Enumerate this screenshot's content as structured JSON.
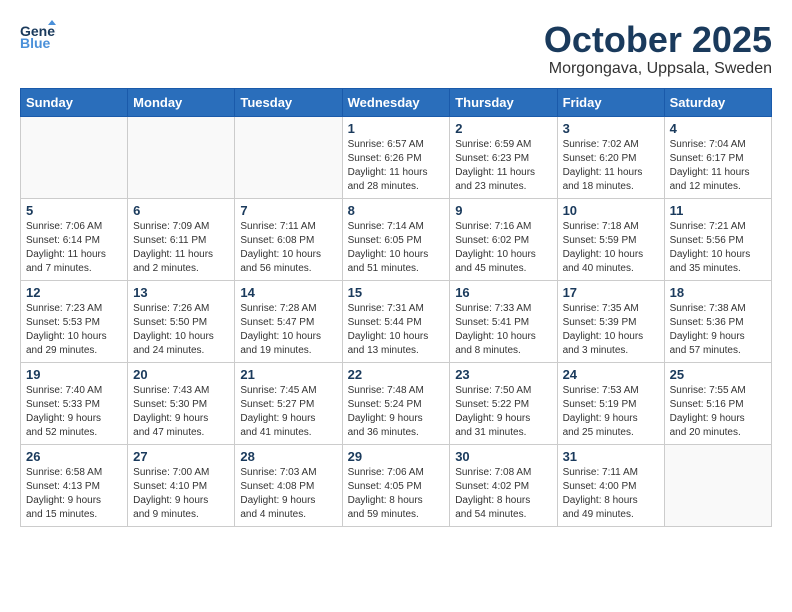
{
  "header": {
    "logo_line1": "General",
    "logo_line2": "Blue",
    "month": "October 2025",
    "location": "Morgongava, Uppsala, Sweden"
  },
  "weekdays": [
    "Sunday",
    "Monday",
    "Tuesday",
    "Wednesday",
    "Thursday",
    "Friday",
    "Saturday"
  ],
  "weeks": [
    [
      {
        "day": "",
        "info": ""
      },
      {
        "day": "",
        "info": ""
      },
      {
        "day": "",
        "info": ""
      },
      {
        "day": "1",
        "info": "Sunrise: 6:57 AM\nSunset: 6:26 PM\nDaylight: 11 hours\nand 28 minutes."
      },
      {
        "day": "2",
        "info": "Sunrise: 6:59 AM\nSunset: 6:23 PM\nDaylight: 11 hours\nand 23 minutes."
      },
      {
        "day": "3",
        "info": "Sunrise: 7:02 AM\nSunset: 6:20 PM\nDaylight: 11 hours\nand 18 minutes."
      },
      {
        "day": "4",
        "info": "Sunrise: 7:04 AM\nSunset: 6:17 PM\nDaylight: 11 hours\nand 12 minutes."
      }
    ],
    [
      {
        "day": "5",
        "info": "Sunrise: 7:06 AM\nSunset: 6:14 PM\nDaylight: 11 hours\nand 7 minutes."
      },
      {
        "day": "6",
        "info": "Sunrise: 7:09 AM\nSunset: 6:11 PM\nDaylight: 11 hours\nand 2 minutes."
      },
      {
        "day": "7",
        "info": "Sunrise: 7:11 AM\nSunset: 6:08 PM\nDaylight: 10 hours\nand 56 minutes."
      },
      {
        "day": "8",
        "info": "Sunrise: 7:14 AM\nSunset: 6:05 PM\nDaylight: 10 hours\nand 51 minutes."
      },
      {
        "day": "9",
        "info": "Sunrise: 7:16 AM\nSunset: 6:02 PM\nDaylight: 10 hours\nand 45 minutes."
      },
      {
        "day": "10",
        "info": "Sunrise: 7:18 AM\nSunset: 5:59 PM\nDaylight: 10 hours\nand 40 minutes."
      },
      {
        "day": "11",
        "info": "Sunrise: 7:21 AM\nSunset: 5:56 PM\nDaylight: 10 hours\nand 35 minutes."
      }
    ],
    [
      {
        "day": "12",
        "info": "Sunrise: 7:23 AM\nSunset: 5:53 PM\nDaylight: 10 hours\nand 29 minutes."
      },
      {
        "day": "13",
        "info": "Sunrise: 7:26 AM\nSunset: 5:50 PM\nDaylight: 10 hours\nand 24 minutes."
      },
      {
        "day": "14",
        "info": "Sunrise: 7:28 AM\nSunset: 5:47 PM\nDaylight: 10 hours\nand 19 minutes."
      },
      {
        "day": "15",
        "info": "Sunrise: 7:31 AM\nSunset: 5:44 PM\nDaylight: 10 hours\nand 13 minutes."
      },
      {
        "day": "16",
        "info": "Sunrise: 7:33 AM\nSunset: 5:41 PM\nDaylight: 10 hours\nand 8 minutes."
      },
      {
        "day": "17",
        "info": "Sunrise: 7:35 AM\nSunset: 5:39 PM\nDaylight: 10 hours\nand 3 minutes."
      },
      {
        "day": "18",
        "info": "Sunrise: 7:38 AM\nSunset: 5:36 PM\nDaylight: 9 hours\nand 57 minutes."
      }
    ],
    [
      {
        "day": "19",
        "info": "Sunrise: 7:40 AM\nSunset: 5:33 PM\nDaylight: 9 hours\nand 52 minutes."
      },
      {
        "day": "20",
        "info": "Sunrise: 7:43 AM\nSunset: 5:30 PM\nDaylight: 9 hours\nand 47 minutes."
      },
      {
        "day": "21",
        "info": "Sunrise: 7:45 AM\nSunset: 5:27 PM\nDaylight: 9 hours\nand 41 minutes."
      },
      {
        "day": "22",
        "info": "Sunrise: 7:48 AM\nSunset: 5:24 PM\nDaylight: 9 hours\nand 36 minutes."
      },
      {
        "day": "23",
        "info": "Sunrise: 7:50 AM\nSunset: 5:22 PM\nDaylight: 9 hours\nand 31 minutes."
      },
      {
        "day": "24",
        "info": "Sunrise: 7:53 AM\nSunset: 5:19 PM\nDaylight: 9 hours\nand 25 minutes."
      },
      {
        "day": "25",
        "info": "Sunrise: 7:55 AM\nSunset: 5:16 PM\nDaylight: 9 hours\nand 20 minutes."
      }
    ],
    [
      {
        "day": "26",
        "info": "Sunrise: 6:58 AM\nSunset: 4:13 PM\nDaylight: 9 hours\nand 15 minutes."
      },
      {
        "day": "27",
        "info": "Sunrise: 7:00 AM\nSunset: 4:10 PM\nDaylight: 9 hours\nand 9 minutes."
      },
      {
        "day": "28",
        "info": "Sunrise: 7:03 AM\nSunset: 4:08 PM\nDaylight: 9 hours\nand 4 minutes."
      },
      {
        "day": "29",
        "info": "Sunrise: 7:06 AM\nSunset: 4:05 PM\nDaylight: 8 hours\nand 59 minutes."
      },
      {
        "day": "30",
        "info": "Sunrise: 7:08 AM\nSunset: 4:02 PM\nDaylight: 8 hours\nand 54 minutes."
      },
      {
        "day": "31",
        "info": "Sunrise: 7:11 AM\nSunset: 4:00 PM\nDaylight: 8 hours\nand 49 minutes."
      },
      {
        "day": "",
        "info": ""
      }
    ]
  ]
}
